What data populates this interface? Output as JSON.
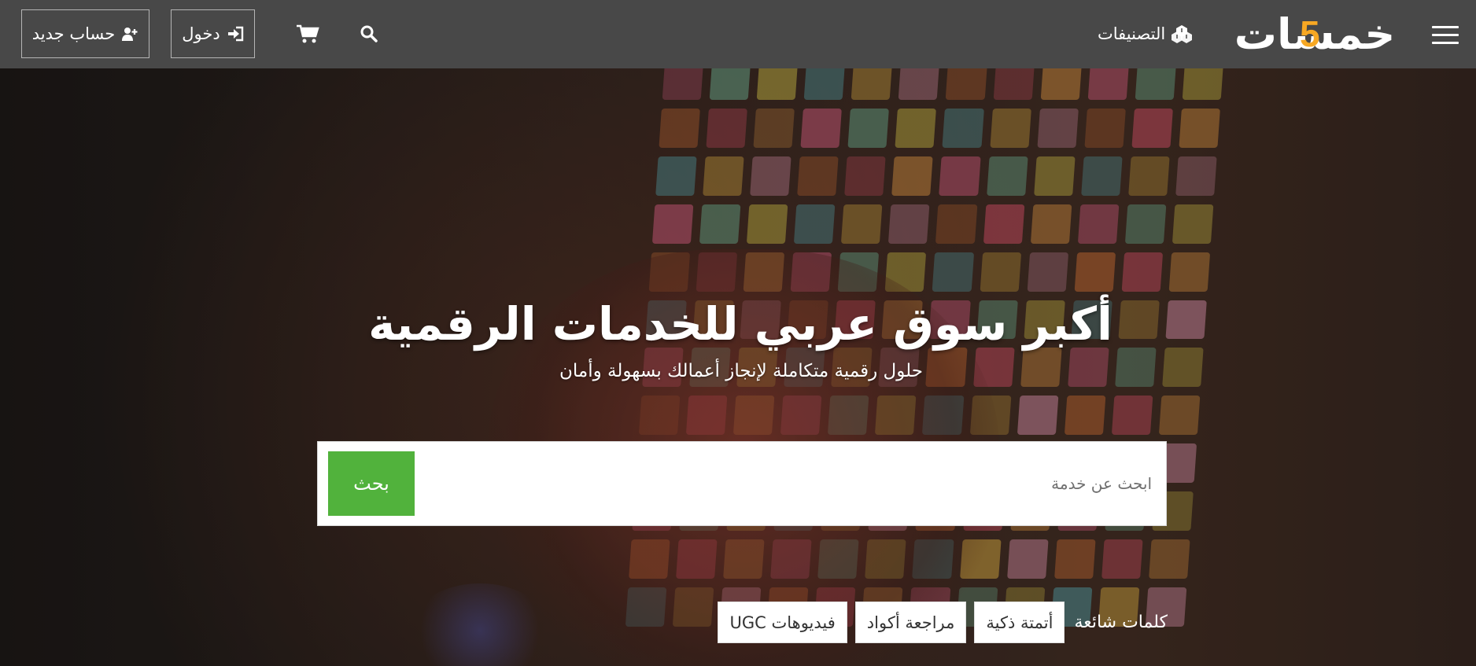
{
  "header": {
    "logo": {
      "text": "خمسات",
      "digit": "5",
      "digit_color": "#f7a823"
    },
    "categories_label": "التصنيفات",
    "login_label": "دخول",
    "register_label": "حساب جديد",
    "icons": {
      "menu": "menu-icon",
      "categories": "categories-icon",
      "search": "search-icon",
      "cart": "cart-icon",
      "login": "login-icon",
      "register": "user-plus-icon"
    },
    "colors": {
      "bar": "#484848",
      "border": "#b5b5b5",
      "text": "#ffffff"
    }
  },
  "hero": {
    "title": "أكبر سوق عربي للخدمات الرقمية",
    "subtitle": "حلول رقمية متكاملة لإنجاز أعمالك بسهولة وأمان",
    "search": {
      "placeholder": "ابحث عن خدمة",
      "value": "",
      "button_label": "بحث",
      "button_color": "#51b23c"
    },
    "popular": {
      "label": "كلمات شائعة",
      "tags": [
        "أتمتة ذكية",
        "مراجعة أكواد",
        "فيديوهات UGC"
      ]
    }
  }
}
